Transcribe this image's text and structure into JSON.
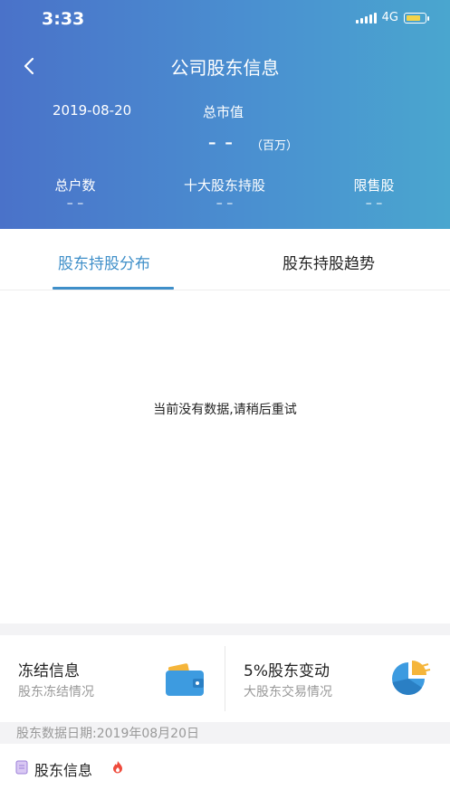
{
  "status_bar": {
    "time": "3:33",
    "network": "4G",
    "battery_color": "#f3d34a"
  },
  "header": {
    "title": "公司股东信息",
    "date": "2019-08-20",
    "market_value_label": "总市值",
    "market_value": "– –",
    "market_value_unit": "（百万）",
    "stats": [
      {
        "label": "总户数",
        "value": "– –"
      },
      {
        "label": "十大股东持股",
        "value": "– –"
      },
      {
        "label": "限售股",
        "value": "– –"
      }
    ],
    "gradient_colors": [
      "#4a72c9",
      "#4aa6cf"
    ]
  },
  "tabs": [
    {
      "label": "股东持股分布",
      "active": true
    },
    {
      "label": "股东持股趋势",
      "active": false
    }
  ],
  "accent_color": "#3f8fc9",
  "content": {
    "empty_message": "当前没有数据,请稍后重试"
  },
  "cards": [
    {
      "title": "冻结信息",
      "subtitle": "股东冻结情况",
      "icon": "wallet-icon"
    },
    {
      "title": "5%股东变动",
      "subtitle": "大股东交易情况",
      "icon": "pie-chart-icon"
    }
  ],
  "data_date": "股东数据日期:2019年08月20日",
  "footer": {
    "label": "股东信息",
    "icon": "document-icon",
    "badge_icon": "flame-icon"
  }
}
